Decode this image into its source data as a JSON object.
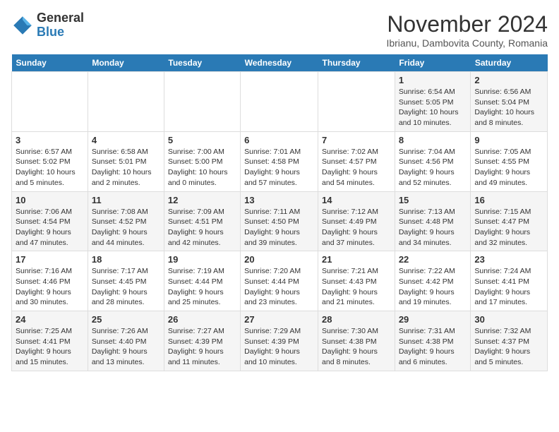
{
  "logo": {
    "general": "General",
    "blue": "Blue"
  },
  "title": "November 2024",
  "location": "Ibrianu, Dambovita County, Romania",
  "days_of_week": [
    "Sunday",
    "Monday",
    "Tuesday",
    "Wednesday",
    "Thursday",
    "Friday",
    "Saturday"
  ],
  "weeks": [
    [
      {
        "day": "",
        "info": ""
      },
      {
        "day": "",
        "info": ""
      },
      {
        "day": "",
        "info": ""
      },
      {
        "day": "",
        "info": ""
      },
      {
        "day": "",
        "info": ""
      },
      {
        "day": "1",
        "info": "Sunrise: 6:54 AM\nSunset: 5:05 PM\nDaylight: 10 hours and 10 minutes."
      },
      {
        "day": "2",
        "info": "Sunrise: 6:56 AM\nSunset: 5:04 PM\nDaylight: 10 hours and 8 minutes."
      }
    ],
    [
      {
        "day": "3",
        "info": "Sunrise: 6:57 AM\nSunset: 5:02 PM\nDaylight: 10 hours and 5 minutes."
      },
      {
        "day": "4",
        "info": "Sunrise: 6:58 AM\nSunset: 5:01 PM\nDaylight: 10 hours and 2 minutes."
      },
      {
        "day": "5",
        "info": "Sunrise: 7:00 AM\nSunset: 5:00 PM\nDaylight: 10 hours and 0 minutes."
      },
      {
        "day": "6",
        "info": "Sunrise: 7:01 AM\nSunset: 4:58 PM\nDaylight: 9 hours and 57 minutes."
      },
      {
        "day": "7",
        "info": "Sunrise: 7:02 AM\nSunset: 4:57 PM\nDaylight: 9 hours and 54 minutes."
      },
      {
        "day": "8",
        "info": "Sunrise: 7:04 AM\nSunset: 4:56 PM\nDaylight: 9 hours and 52 minutes."
      },
      {
        "day": "9",
        "info": "Sunrise: 7:05 AM\nSunset: 4:55 PM\nDaylight: 9 hours and 49 minutes."
      }
    ],
    [
      {
        "day": "10",
        "info": "Sunrise: 7:06 AM\nSunset: 4:54 PM\nDaylight: 9 hours and 47 minutes."
      },
      {
        "day": "11",
        "info": "Sunrise: 7:08 AM\nSunset: 4:52 PM\nDaylight: 9 hours and 44 minutes."
      },
      {
        "day": "12",
        "info": "Sunrise: 7:09 AM\nSunset: 4:51 PM\nDaylight: 9 hours and 42 minutes."
      },
      {
        "day": "13",
        "info": "Sunrise: 7:11 AM\nSunset: 4:50 PM\nDaylight: 9 hours and 39 minutes."
      },
      {
        "day": "14",
        "info": "Sunrise: 7:12 AM\nSunset: 4:49 PM\nDaylight: 9 hours and 37 minutes."
      },
      {
        "day": "15",
        "info": "Sunrise: 7:13 AM\nSunset: 4:48 PM\nDaylight: 9 hours and 34 minutes."
      },
      {
        "day": "16",
        "info": "Sunrise: 7:15 AM\nSunset: 4:47 PM\nDaylight: 9 hours and 32 minutes."
      }
    ],
    [
      {
        "day": "17",
        "info": "Sunrise: 7:16 AM\nSunset: 4:46 PM\nDaylight: 9 hours and 30 minutes."
      },
      {
        "day": "18",
        "info": "Sunrise: 7:17 AM\nSunset: 4:45 PM\nDaylight: 9 hours and 28 minutes."
      },
      {
        "day": "19",
        "info": "Sunrise: 7:19 AM\nSunset: 4:44 PM\nDaylight: 9 hours and 25 minutes."
      },
      {
        "day": "20",
        "info": "Sunrise: 7:20 AM\nSunset: 4:44 PM\nDaylight: 9 hours and 23 minutes."
      },
      {
        "day": "21",
        "info": "Sunrise: 7:21 AM\nSunset: 4:43 PM\nDaylight: 9 hours and 21 minutes."
      },
      {
        "day": "22",
        "info": "Sunrise: 7:22 AM\nSunset: 4:42 PM\nDaylight: 9 hours and 19 minutes."
      },
      {
        "day": "23",
        "info": "Sunrise: 7:24 AM\nSunset: 4:41 PM\nDaylight: 9 hours and 17 minutes."
      }
    ],
    [
      {
        "day": "24",
        "info": "Sunrise: 7:25 AM\nSunset: 4:41 PM\nDaylight: 9 hours and 15 minutes."
      },
      {
        "day": "25",
        "info": "Sunrise: 7:26 AM\nSunset: 4:40 PM\nDaylight: 9 hours and 13 minutes."
      },
      {
        "day": "26",
        "info": "Sunrise: 7:27 AM\nSunset: 4:39 PM\nDaylight: 9 hours and 11 minutes."
      },
      {
        "day": "27",
        "info": "Sunrise: 7:29 AM\nSunset: 4:39 PM\nDaylight: 9 hours and 10 minutes."
      },
      {
        "day": "28",
        "info": "Sunrise: 7:30 AM\nSunset: 4:38 PM\nDaylight: 9 hours and 8 minutes."
      },
      {
        "day": "29",
        "info": "Sunrise: 7:31 AM\nSunset: 4:38 PM\nDaylight: 9 hours and 6 minutes."
      },
      {
        "day": "30",
        "info": "Sunrise: 7:32 AM\nSunset: 4:37 PM\nDaylight: 9 hours and 5 minutes."
      }
    ]
  ]
}
